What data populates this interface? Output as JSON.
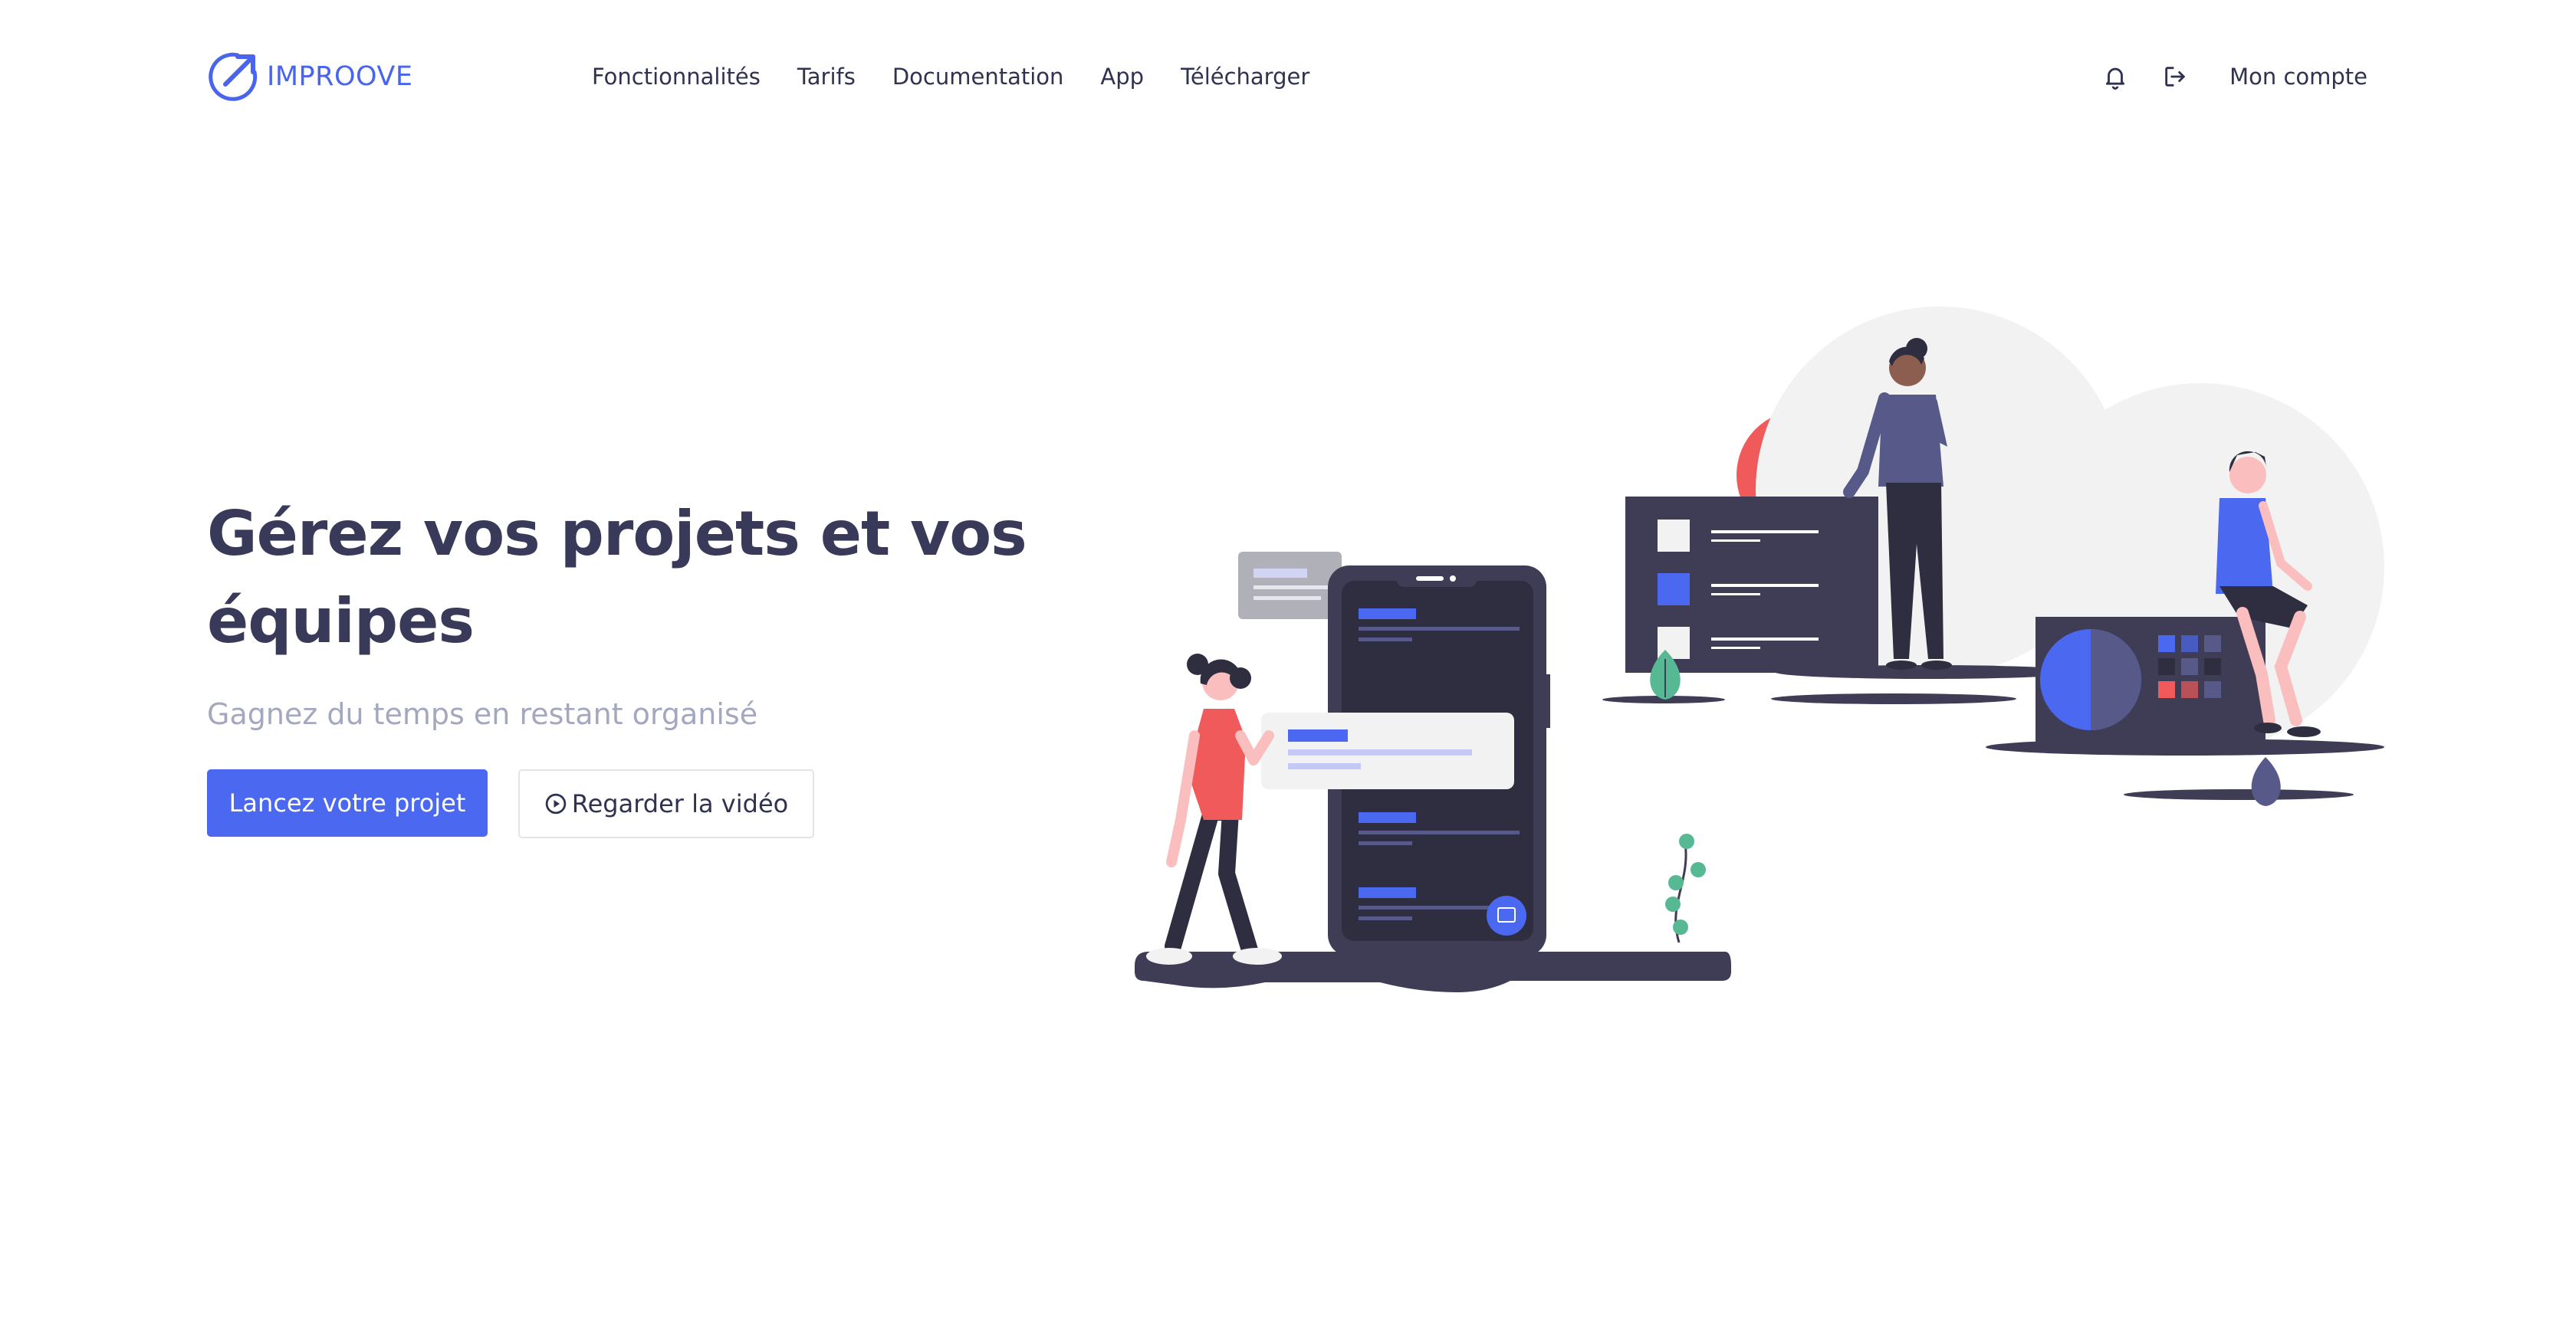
{
  "brand": {
    "name": "IMPROOVE",
    "color": "#4a65ed"
  },
  "nav": {
    "links": [
      "Fonctionnalités",
      "Tarifs",
      "Documentation",
      "App",
      "Télécharger"
    ],
    "account_label": "Mon compte",
    "icons": [
      "bell-icon",
      "logout-icon"
    ]
  },
  "hero": {
    "title": "Gérez vos projets et vos équipes",
    "subtitle": "Gagnez du temps en restant organisé",
    "primary_button": "Lancez votre projet",
    "secondary_button": "Regarder la vidéo"
  },
  "colors": {
    "accent": "#4b68f0",
    "title": "#393a5a",
    "subtitle": "#a3a8bf",
    "illustration_dark": "#3f3d56",
    "illustration_red": "#f05a5a"
  }
}
